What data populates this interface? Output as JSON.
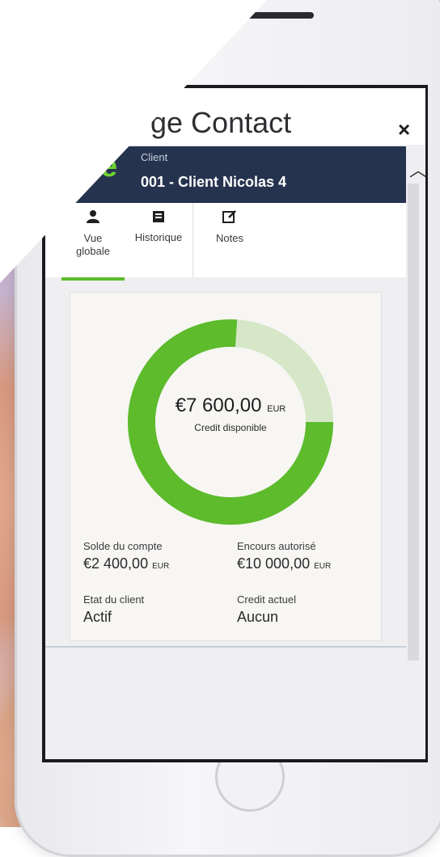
{
  "window": {
    "title": "ge Contact",
    "close_symbol": "×"
  },
  "client": {
    "label": "Client",
    "name": "001 - Client Nicolas 4",
    "logo_glyph": "e"
  },
  "tabs": [
    {
      "label_line1": "Vue",
      "label_line2": "globale",
      "icon": "user-icon",
      "active": true
    },
    {
      "label_line1": "Historique",
      "label_line2": "",
      "icon": "history-icon",
      "active": false
    },
    {
      "label_line1": "Notes",
      "label_line2": "",
      "icon": "edit-icon",
      "active": false
    }
  ],
  "credit": {
    "amount": "€7 600,00",
    "currency": "EUR",
    "label": "Credit disponible",
    "available_fraction": 0.76
  },
  "stats": {
    "solde_label": "Solde du compte",
    "solde_value": "€2 400,00",
    "solde_currency": "EUR",
    "encours_label": "Encours autorisé",
    "encours_value": "€10 000,00",
    "encours_currency": "EUR",
    "etat_label": "Etat du client",
    "etat_value": "Actif",
    "credit_actuel_label": "Credit actuel",
    "credit_actuel_value": "Aucun"
  },
  "colors": {
    "accent_green": "#5dbb2c",
    "light_green": "#d6e7c8",
    "header_navy": "#26334f"
  }
}
